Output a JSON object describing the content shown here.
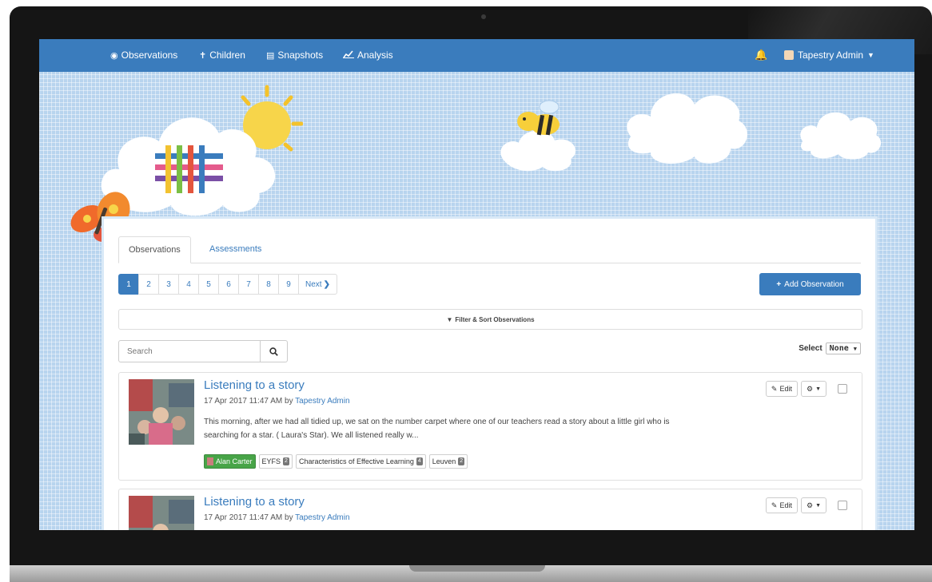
{
  "navbar": {
    "items": [
      {
        "label": "Observations",
        "icon": "eye-icon"
      },
      {
        "label": "Children",
        "icon": "child-icon"
      },
      {
        "label": "Snapshots",
        "icon": "list-icon"
      },
      {
        "label": "Analysis",
        "icon": "chart-icon"
      }
    ],
    "notification_icon": "bell-icon",
    "user": "Tapestry Admin",
    "color": "#3a7cbd"
  },
  "tabs": [
    "Observations",
    "Assessments"
  ],
  "pagination": {
    "pages": [
      "1",
      "2",
      "3",
      "4",
      "5",
      "6",
      "7",
      "8",
      "9"
    ],
    "active": "1",
    "next_label": "Next"
  },
  "add_button": "Add Observation",
  "filter_label": "Filter & Sort Observations",
  "search": {
    "placeholder": "Search"
  },
  "select": {
    "label": "Select",
    "value": "None"
  },
  "observations": [
    {
      "title": "Listening to a story",
      "date": "17 Apr 2017 11:47 AM by",
      "author": "Tapestry Admin",
      "description": "This morning, after we had all tidied up, we sat on the number carpet where one of our teachers read a story about a little girl who is searching for a star. ( Laura's Star). We all listened really w...",
      "tags": [
        {
          "label": "Alan Carter",
          "type": "child"
        },
        {
          "label": "EYFS",
          "count": "2"
        },
        {
          "label": "Characteristics of Effective Learning",
          "count": "4"
        },
        {
          "label": "Leuven",
          "count": "2"
        }
      ],
      "edit_label": "Edit"
    },
    {
      "title": "Listening to a story",
      "date": "17 Apr 2017 11:47 AM by",
      "author": "Tapestry Admin",
      "edit_label": "Edit"
    }
  ]
}
